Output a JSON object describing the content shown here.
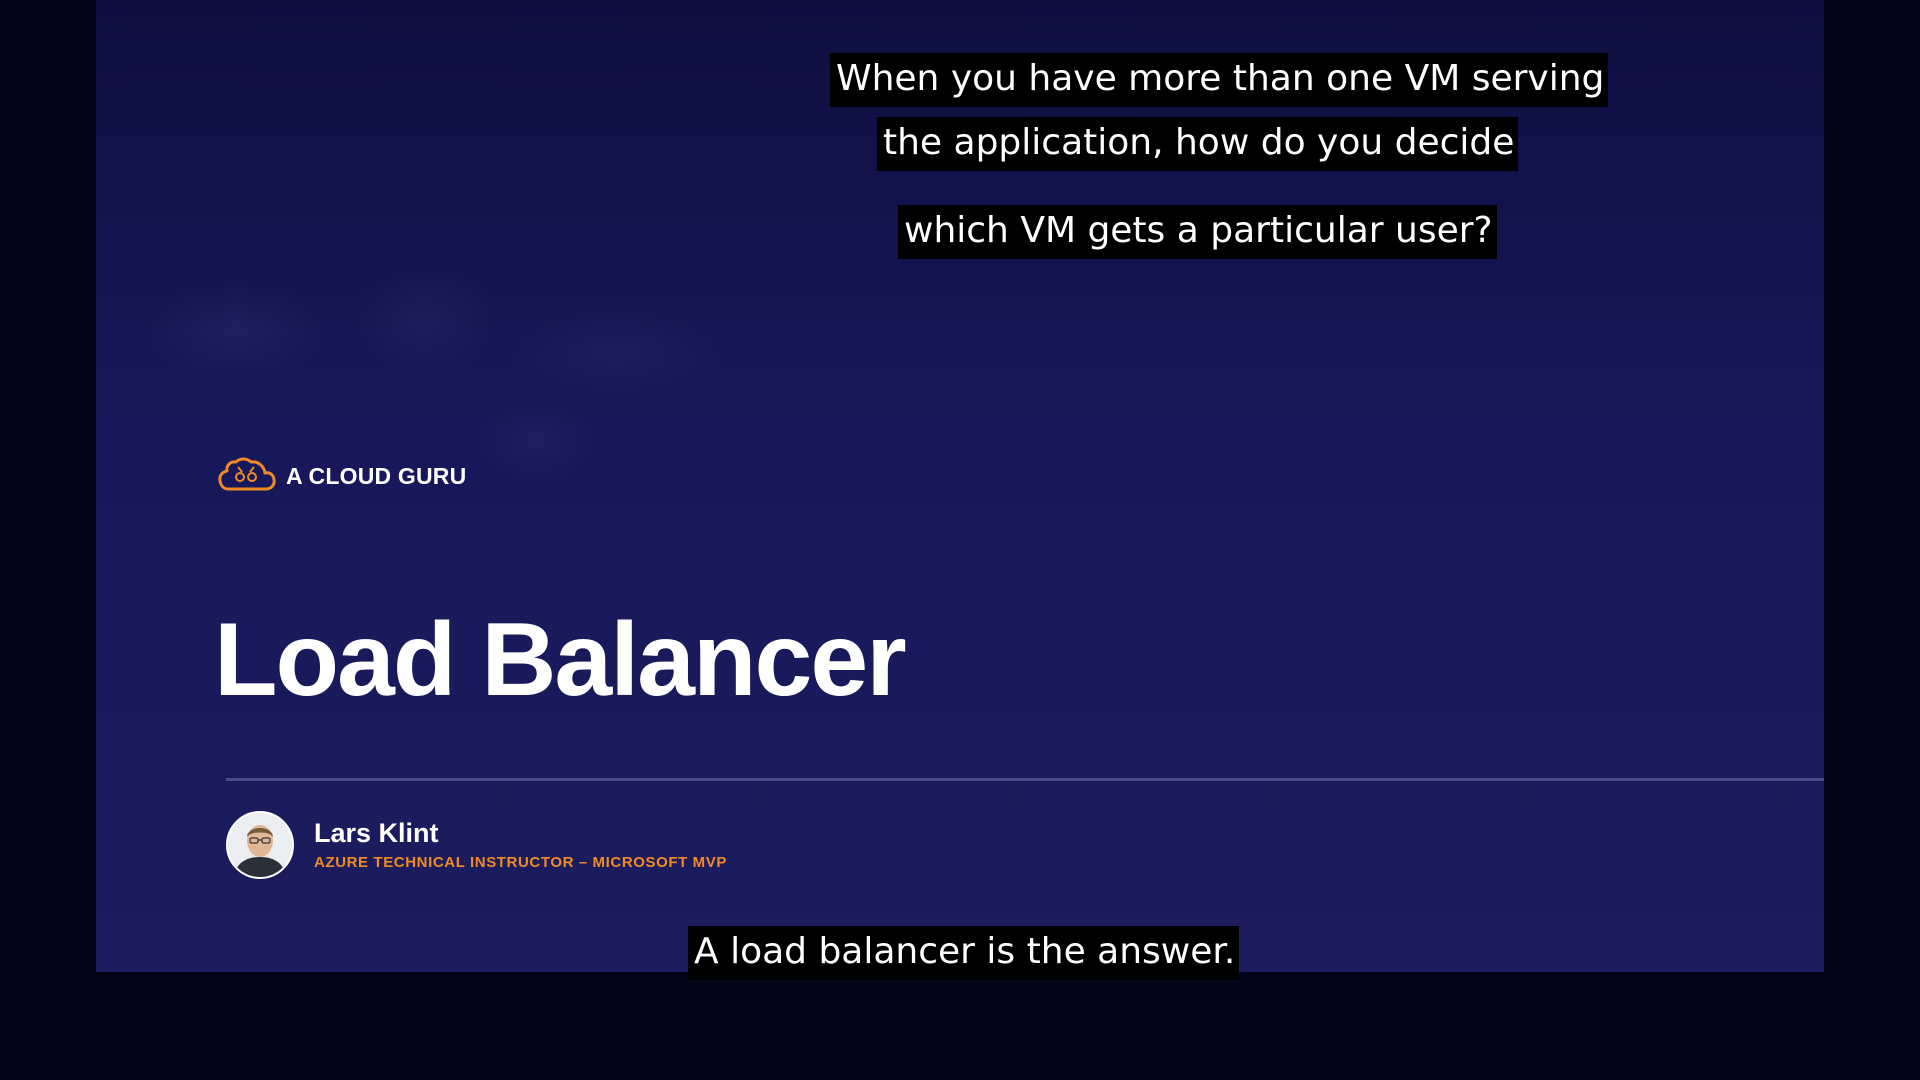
{
  "slide": {
    "logo_icon": "cloud-guru-icon",
    "logo_text": "A CLOUD GURU",
    "title": "Load Balancer",
    "presenter": {
      "name": "Lars Klint",
      "role": "AZURE TECHNICAL INSTRUCTOR – MICROSOFT MVP",
      "avatar_icon": "presenter-avatar"
    }
  },
  "captions": {
    "top_lines": [
      "When you have more than one VM serving",
      "the application, how do you decide",
      "which VM gets a particular user?"
    ],
    "bottom": "A load balancer is the answer."
  },
  "colors": {
    "background": "#05051a",
    "slide_top": "#0e0f3f",
    "slide_bottom": "#1c1d5e",
    "accent_orange": "#f08a24",
    "caption_bg": "#000000",
    "text": "#ffffff"
  }
}
